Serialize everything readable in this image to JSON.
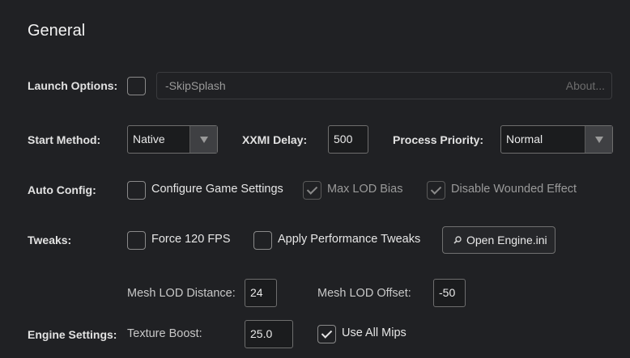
{
  "section": {
    "title": "General"
  },
  "launch_options": {
    "label": "Launch Options:",
    "checked": false,
    "value": "-SkipSplash",
    "about": "About..."
  },
  "start_method": {
    "label": "Start Method:",
    "selected": "Native"
  },
  "xxmi_delay": {
    "label": "XXMI Delay:",
    "value": "500"
  },
  "process_priority": {
    "label": "Process Priority:",
    "selected": "Normal"
  },
  "auto_config": {
    "label": "Auto Config:",
    "configure_game_settings": {
      "label": "Configure Game Settings",
      "checked": false
    },
    "max_lod_bias": {
      "label": "Max LOD Bias",
      "checked": true,
      "enabled": false
    },
    "disable_wounded_effect": {
      "label": "Disable Wounded Effect",
      "checked": true,
      "enabled": false
    }
  },
  "tweaks": {
    "label": "Tweaks:",
    "force_120_fps": {
      "label": "Force 120 FPS",
      "checked": false
    },
    "apply_performance_tweaks": {
      "label": "Apply Performance Tweaks",
      "checked": false
    },
    "open_engine_ini": {
      "label": "Open Engine.ini",
      "icon": "magnifier-icon"
    }
  },
  "engine_settings": {
    "label": "Engine Settings:",
    "mesh_lod_distance": {
      "label": "Mesh LOD Distance:",
      "value": "24"
    },
    "mesh_lod_offset": {
      "label": "Mesh LOD Offset:",
      "value": "-50"
    },
    "texture_boost": {
      "label": "Texture Boost:",
      "value": "25.0"
    },
    "use_all_mips": {
      "label": "Use All Mips",
      "checked": true
    }
  }
}
